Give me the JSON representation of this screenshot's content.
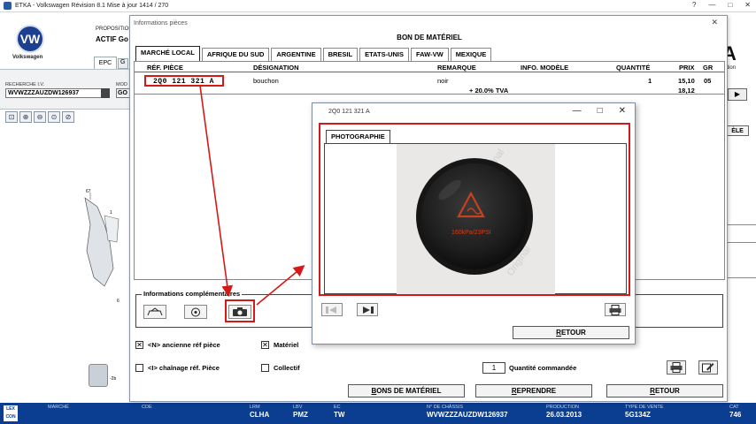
{
  "main_window": {
    "title": "ETKA - Volkswagen Révision 8.1 Mise à jour 1414 / 270",
    "controls": [
      "?",
      "—",
      "□",
      "✕"
    ]
  },
  "background": {
    "brand_label": "Volkswagen",
    "proposition_label": "PROPOSITION",
    "actif_text": "ACTIF  Go",
    "tab_epc": "EPC",
    "tab_g": "G",
    "recherche_label": "RECHERCHE I.V.",
    "vin_value": "WVWZZZAUZDW126937",
    "model_label": "MOD",
    "model_value": "GO",
    "right_brand": "A",
    "right_sub": "ation",
    "right_btn_arrow": "▶",
    "right_btn_text": "ÈLE",
    "diagram_labels": [
      "67",
      "1",
      "6",
      "-2b"
    ]
  },
  "statusbar": {
    "logo": "LEX CON",
    "cells": [
      {
        "key": "MARCHÉ",
        "value": ""
      },
      {
        "key": "CDE",
        "value": ""
      },
      {
        "key": "LRM",
        "value": "CLHA"
      },
      {
        "key": "LBV",
        "value": "PMZ"
      },
      {
        "key": "EC",
        "value": "TW"
      },
      {
        "key": "N° DE CHÂSSIS",
        "value": "WVWZZZAUZDW126937"
      },
      {
        "key": "PRODUCTION",
        "value": "26.03.2013"
      },
      {
        "key": "TYPE DE VENTE",
        "value": "5G134Z"
      },
      {
        "key": "CAT",
        "value": "746"
      }
    ]
  },
  "info_window": {
    "title": "Informations pièces",
    "close": "✕",
    "heading": "BON DE MATÉRIEL",
    "tabs": [
      "MARCHÉ LOCAL",
      "AFRIQUE DU SUD",
      "ARGENTINE",
      "BRESIL",
      "ETATS-UNIS",
      "FAW-VW",
      "MEXIQUE"
    ],
    "columns": {
      "ref": "RÉF. PIÈCE",
      "designation": "DÉSIGNATION",
      "remarque": "REMARQUE",
      "info_modele": "INFO. MODÈLE",
      "quantite": "QUANTITÉ",
      "prix": "PRIX",
      "gr": "GR"
    },
    "row": {
      "ref": "2Q0 121 321 A",
      "designation": "bouchon",
      "remarque": "noir",
      "quantite": "1",
      "prix": "15,10",
      "gr": "05",
      "tva_label": "+ 20.0% TVA",
      "prix_ttc": "18,12"
    },
    "complementaires_label": "Informations complémentaires",
    "checkboxes": {
      "ancienne": {
        "label": "<N> ancienne réf pièce",
        "mark": "✕"
      },
      "materiel": {
        "label": "Matériel",
        "mark": "✕"
      },
      "chainage": {
        "label": "<I> chaînage réf. Pièce",
        "mark": ""
      },
      "collectif": {
        "label": "Collectif",
        "mark": ""
      }
    },
    "quantity_value": "1",
    "quantity_label": "Quantité commandée",
    "buttons": {
      "bons": "BONS DE MATÉRIEL",
      "reprendre": "REPRENDRE",
      "retour": "RETOUR"
    }
  },
  "photo_window": {
    "title": "2Q0 121 321 A",
    "controls": [
      "—",
      "□",
      "✕"
    ],
    "tab": "PHOTOGRAPHIE",
    "cap_marking": "160kPa/23PSI",
    "watermark": "Original",
    "retour": "RETOUR"
  },
  "colors": {
    "statusbar": "#0b3d91",
    "highlight": "#d41919",
    "warning_icon": "#c8401e"
  }
}
